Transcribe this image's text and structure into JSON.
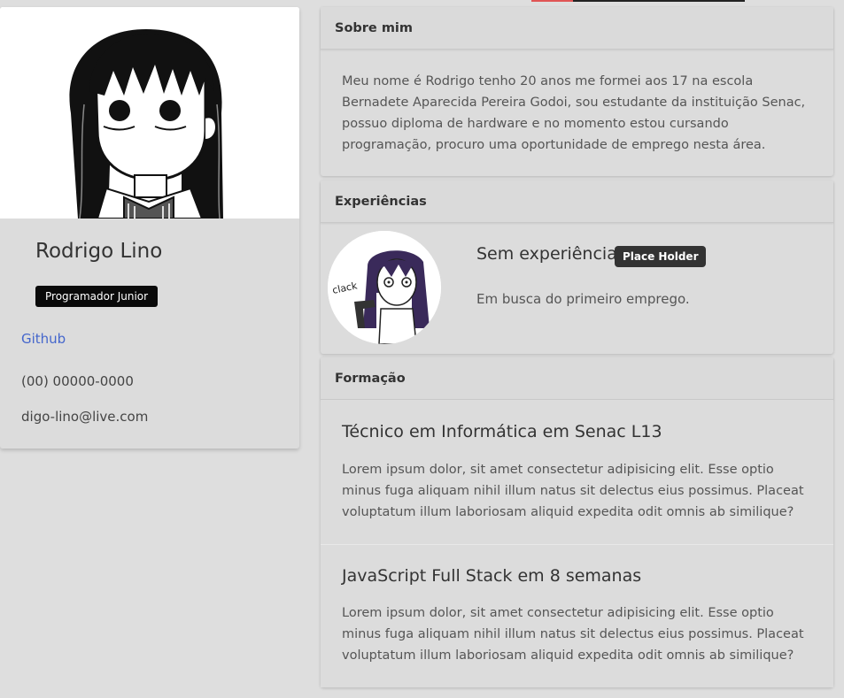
{
  "profile": {
    "name": "Rodrigo Lino",
    "role": "Programador Junior",
    "github_label": "Github",
    "phone": "(00) 00000-0000",
    "email": "digo-lino@live.com"
  },
  "about": {
    "header": "Sobre mim",
    "text": "Meu nome é Rodrigo tenho 20 anos me formei aos 17 na escola Bernadete Aparecida Pereira Godoi, sou estudante da instituição Senac, possuo diploma de hardware e no momento estou cursando programação, procuro uma oportunidade de emprego nesta área."
  },
  "experience": {
    "header": "Experiências",
    "title": "Sem experiência",
    "badge": "Place Holder",
    "description": "Em busca do primeiro emprego.",
    "avatar_caption": "clack"
  },
  "education": {
    "header": "Formação",
    "items": [
      {
        "title": "Técnico em Informática em Senac L13",
        "description": "Lorem ipsum dolor, sit amet consectetur adipisicing elit. Esse optio minus fuga aliquam nihil illum natus sit delectus eius possimus. Placeat voluptatum illum laboriosam aliquid expedita odit omnis ab similique?"
      },
      {
        "title": "JavaScript Full Stack em 8 semanas",
        "description": "Lorem ipsum dolor, sit amet consectetur adipisicing elit. Esse optio minus fuga aliquam nihil illum natus sit delectus eius possimus. Placeat voluptatum illum laboriosam aliquid expedita odit omnis ab similique?"
      }
    ]
  },
  "colors": {
    "background": "#dedede",
    "card": "#dcdcdc",
    "badge_dark": "#0a0a0a",
    "link": "#4466cc"
  }
}
